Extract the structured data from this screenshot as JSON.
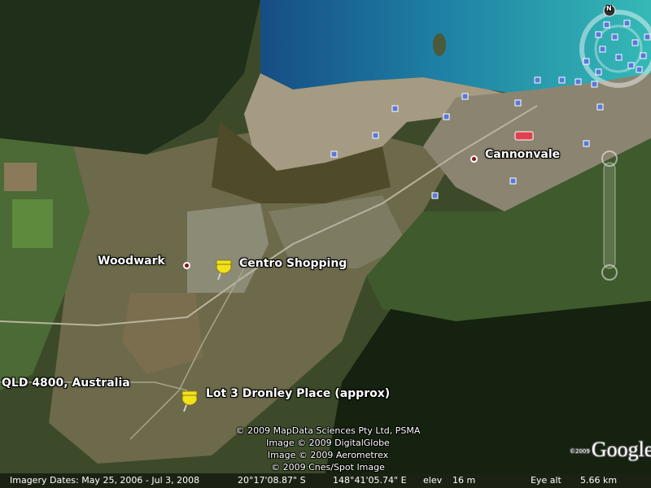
{
  "places": {
    "cannonvale": "Cannonvale",
    "woodwark": "Woodwark",
    "centro": "Centro Shopping",
    "qld": "QLD 4800, Australia",
    "lot3": "Lot 3 Dronley Place (approx)"
  },
  "credits": [
    "© 2009 MapData Sciences Pty Ltd, PSMA",
    "Image © 2009 DigitalGlobe",
    "Image © 2009 Aerometrex",
    "© 2009 Cnes/Spot Image"
  ],
  "status": {
    "imagery_dates": "Imagery Dates: May 25, 2006 - Jul 3, 2008",
    "lat": "20°17'08.87\" S",
    "lon": "148°41'05.74\" E",
    "elev_label": "elev",
    "elev_value": "16 m",
    "eye_alt_label": "Eye alt",
    "eye_alt_value": "5.66 km"
  },
  "logo": {
    "prefix": "©2009",
    "text": "Google"
  },
  "compass": {
    "north": "N"
  },
  "colors": {
    "marker": "#8a0d15",
    "pushpin": "#f2e21b",
    "poi": "#5a78d8",
    "water": "#2fa6b0"
  }
}
